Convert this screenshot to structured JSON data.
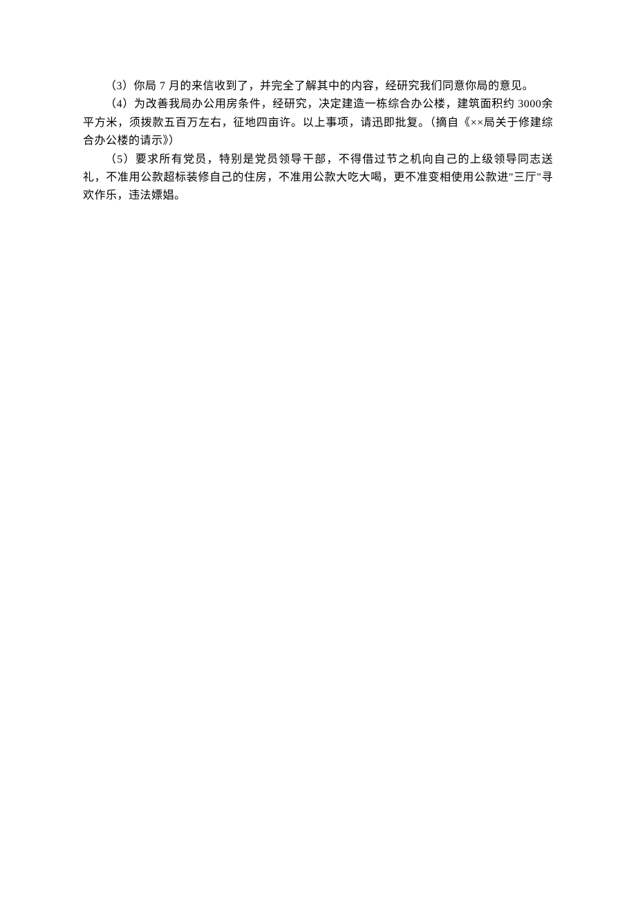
{
  "paragraphs": [
    {
      "text": "（3）你局 7 月的来信收到了，并完全了解其中的内容，经研究我们同意你局的意见。",
      "indented": true
    },
    {
      "text": "（4）为改善我局办公用房条件，经研究，决定建造一栋综合办公楼，建筑面积约 3000余平方米，须拨款五百万左右，征地四亩许。以上事项，请迅即批复。（摘自《××局关于修建综合办公楼的请示》）",
      "indented": true
    },
    {
      "text": "（5）要求所有党员，特别是党员领导干部，不得借过节之机向自己的上级领导同志送礼，不准用公款超标装修自己的住房，不准用公款大吃大喝，更不准变相使用公款进\"三厅\"寻欢作乐，违法嫖娼。",
      "indented": true
    }
  ]
}
